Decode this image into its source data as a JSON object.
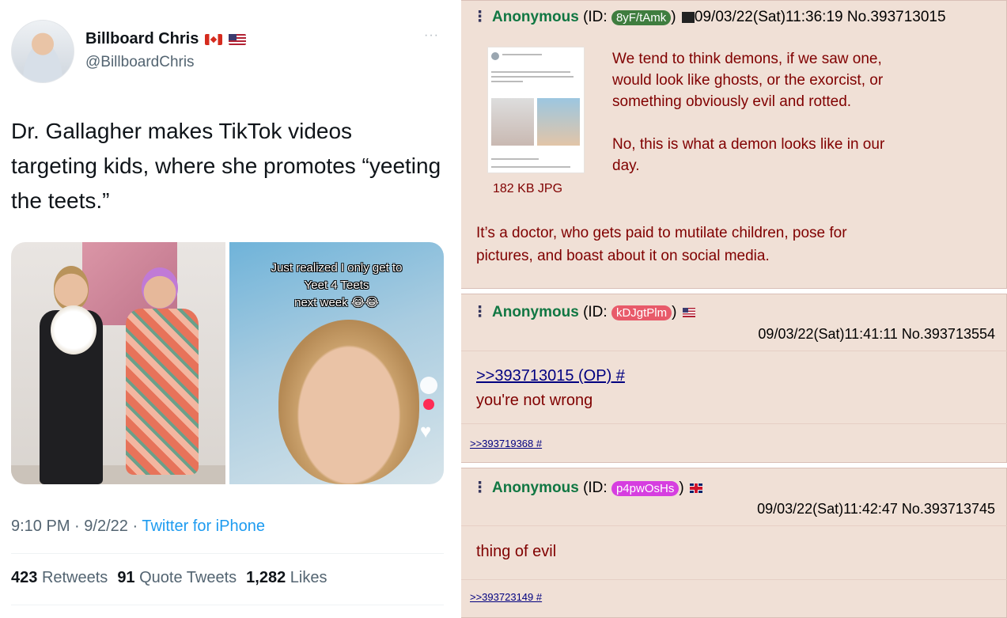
{
  "tweet": {
    "display_name": "Billboard Chris",
    "handle": "@BillboardChris",
    "more": "···",
    "text": "Dr. Gallagher makes TikTok videos targeting kids, where she promotes “yeeting the teets.”",
    "photo2_caption_line1": "Just realized I only get to",
    "photo2_caption_line2": "Yeet 4 Teets",
    "photo2_caption_line3": "next week 😂😂",
    "time": "9:10 PM",
    "date": "9/2/22",
    "source": "Twitter for iPhone",
    "sep": "·",
    "retweets_count": "423",
    "retweets_label": "Retweets",
    "quote_count": "91",
    "quote_label": "Quote Tweets",
    "likes_count": "1,282",
    "likes_label": "Likes"
  },
  "posts": {
    "op": {
      "dots": "⋮",
      "name": "Anonymous",
      "id_prefix": "(ID:",
      "id": "8yF/tAmk",
      "id_suffix": ")",
      "id_color": "#3f7d3f",
      "datetime": "09/03/22(Sat)11:36:19 No.393713015",
      "file_size": "182 KB JPG",
      "text_p1_lines": [
        "We tend to think demons, if we saw one,",
        "would look like ghosts, or the exorcist, or",
        "something obviously evil and rotted."
      ],
      "text_p2_lines": [
        "No, this is what a demon looks like in our",
        "day."
      ],
      "text_p3_lines": [
        "It’s a doctor, who gets paid to mutilate children, pose for",
        "pictures, and boast about it on social media."
      ]
    },
    "reply1": {
      "dots": "⋮",
      "name": "Anonymous",
      "id_prefix": "(ID:",
      "id": "kDJgtPlm",
      "id_suffix": ")",
      "id_color": "#e85a6a",
      "datetime": "09/03/22(Sat)11:41:11 No.393713554",
      "quote": ">>393713015 (OP) #",
      "text": "you're not wrong",
      "backlink": ">>393719368 #"
    },
    "reply2": {
      "dots": "⋮",
      "name": "Anonymous",
      "id_prefix": "(ID:",
      "id": "p4pwOsHs",
      "id_suffix": ")",
      "id_color": "#d63ee0",
      "datetime": "09/03/22(Sat)11:42:47 No.393713745",
      "text": "thing of evil",
      "backlink": ">>393723149 #"
    }
  }
}
